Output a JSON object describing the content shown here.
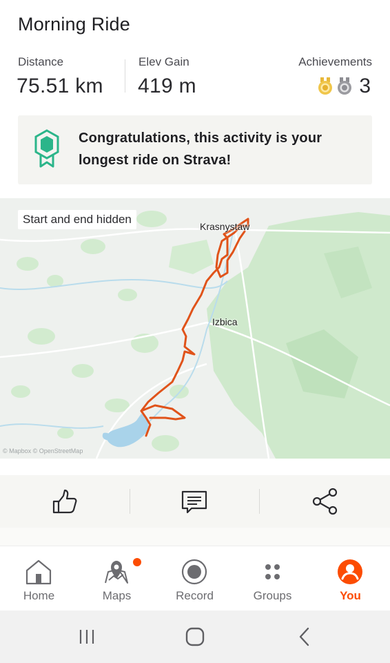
{
  "activity": {
    "title": "Morning Ride",
    "stats": [
      {
        "label": "Distance",
        "value": "75.51 km"
      },
      {
        "label": "Elev Gain",
        "value": "419 m"
      }
    ],
    "achievements": {
      "label": "Achievements",
      "count": "3",
      "medals": [
        "gold-medal",
        "silver-medal"
      ]
    }
  },
  "banner": {
    "text": "Congratulations, this activity is your longest ride on Strava!",
    "icon": "hexagon-ribbon-icon",
    "icon_color": "#2bb58a"
  },
  "map": {
    "privacy_badge": "Start and end hidden",
    "places": [
      "Krasnystaw",
      "Izbica"
    ],
    "attribution": "© Mapbox © OpenStreetMap",
    "route_color": "#e0531a",
    "forest_color": "#cfe9cc"
  },
  "actions": [
    {
      "name": "kudos",
      "icon": "thumbs-up-icon"
    },
    {
      "name": "comment",
      "icon": "comment-icon"
    },
    {
      "name": "share",
      "icon": "share-icon"
    }
  ],
  "tabs": [
    {
      "label": "Home",
      "icon": "home-icon",
      "active": false
    },
    {
      "label": "Maps",
      "icon": "map-pin-icon",
      "active": false,
      "badge": true
    },
    {
      "label": "Record",
      "icon": "record-icon",
      "active": false
    },
    {
      "label": "Groups",
      "icon": "groups-icon",
      "active": false
    },
    {
      "label": "You",
      "icon": "profile-icon",
      "active": true
    }
  ],
  "accent_color": "#fc4c02",
  "system_nav": [
    "recent-apps-icon",
    "home-circle-icon",
    "back-icon"
  ]
}
